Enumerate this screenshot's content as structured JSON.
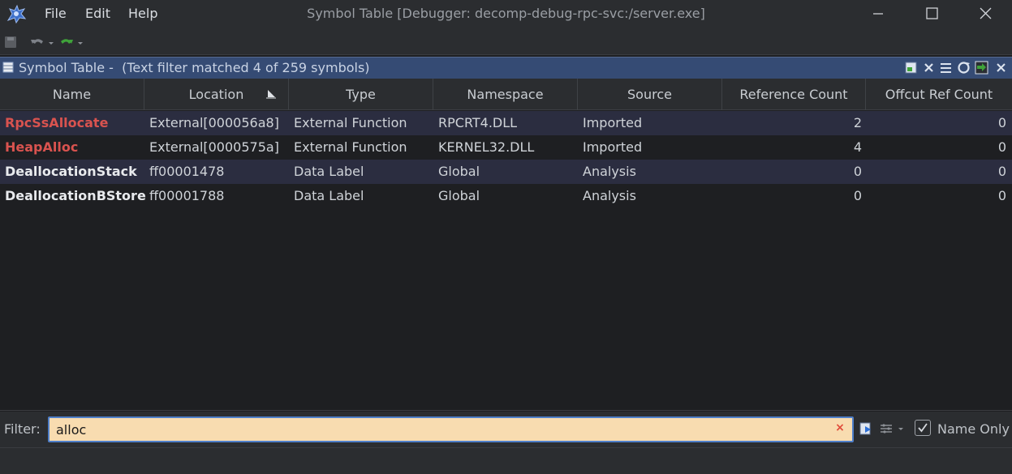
{
  "window": {
    "title": "Symbol Table [Debugger: decomp-debug-rpc-svc:/server.exe]"
  },
  "menu": {
    "file": "File",
    "edit": "Edit",
    "help": "Help"
  },
  "component": {
    "title": "Symbol Table -  (Text filter matched 4 of 259 symbols)"
  },
  "table": {
    "columns": [
      "Name",
      "Location",
      "Type",
      "Namespace",
      "Source",
      "Reference Count",
      "Offcut Ref Count"
    ],
    "rows": [
      {
        "name": "RpcSsAllocate",
        "location": "External[000056a8]",
        "type": "External Function",
        "namespace": "RPCRT4.DLL",
        "source": "Imported",
        "ref_count": "2",
        "offcut_ref_count": "0"
      },
      {
        "name": "HeapAlloc",
        "location": "External[0000575a]",
        "type": "External Function",
        "namespace": "KERNEL32.DLL",
        "source": "Imported",
        "ref_count": "4",
        "offcut_ref_count": "0"
      },
      {
        "name": "DeallocationStack",
        "location": "ff00001478",
        "type": "Data Label",
        "namespace": "Global",
        "source": "Analysis",
        "ref_count": "0",
        "offcut_ref_count": "0"
      },
      {
        "name": "DeallocationBStore",
        "location": "ff00001788",
        "type": "Data Label",
        "namespace": "Global",
        "source": "Analysis",
        "ref_count": "0",
        "offcut_ref_count": "0"
      }
    ]
  },
  "filter": {
    "label": "Filter:",
    "value": "alloc",
    "clear_symbol": "×",
    "name_only_label": "Name Only",
    "name_only_checked": true
  },
  "colors": {
    "external_symbol": "#d9534f",
    "header_bar": "#354b74",
    "filter_background": "#f8dcb0",
    "filter_border": "#4f7fc9"
  },
  "icons": {
    "app": "ghidra-dragon-icon",
    "minimize": "minimize-icon",
    "maximize": "maximize-icon",
    "close": "close-icon",
    "save": "save-icon",
    "undo": "undo-icon",
    "redo": "redo-icon",
    "table_header": "table-icon",
    "sort": "sort-indicator-icon"
  }
}
